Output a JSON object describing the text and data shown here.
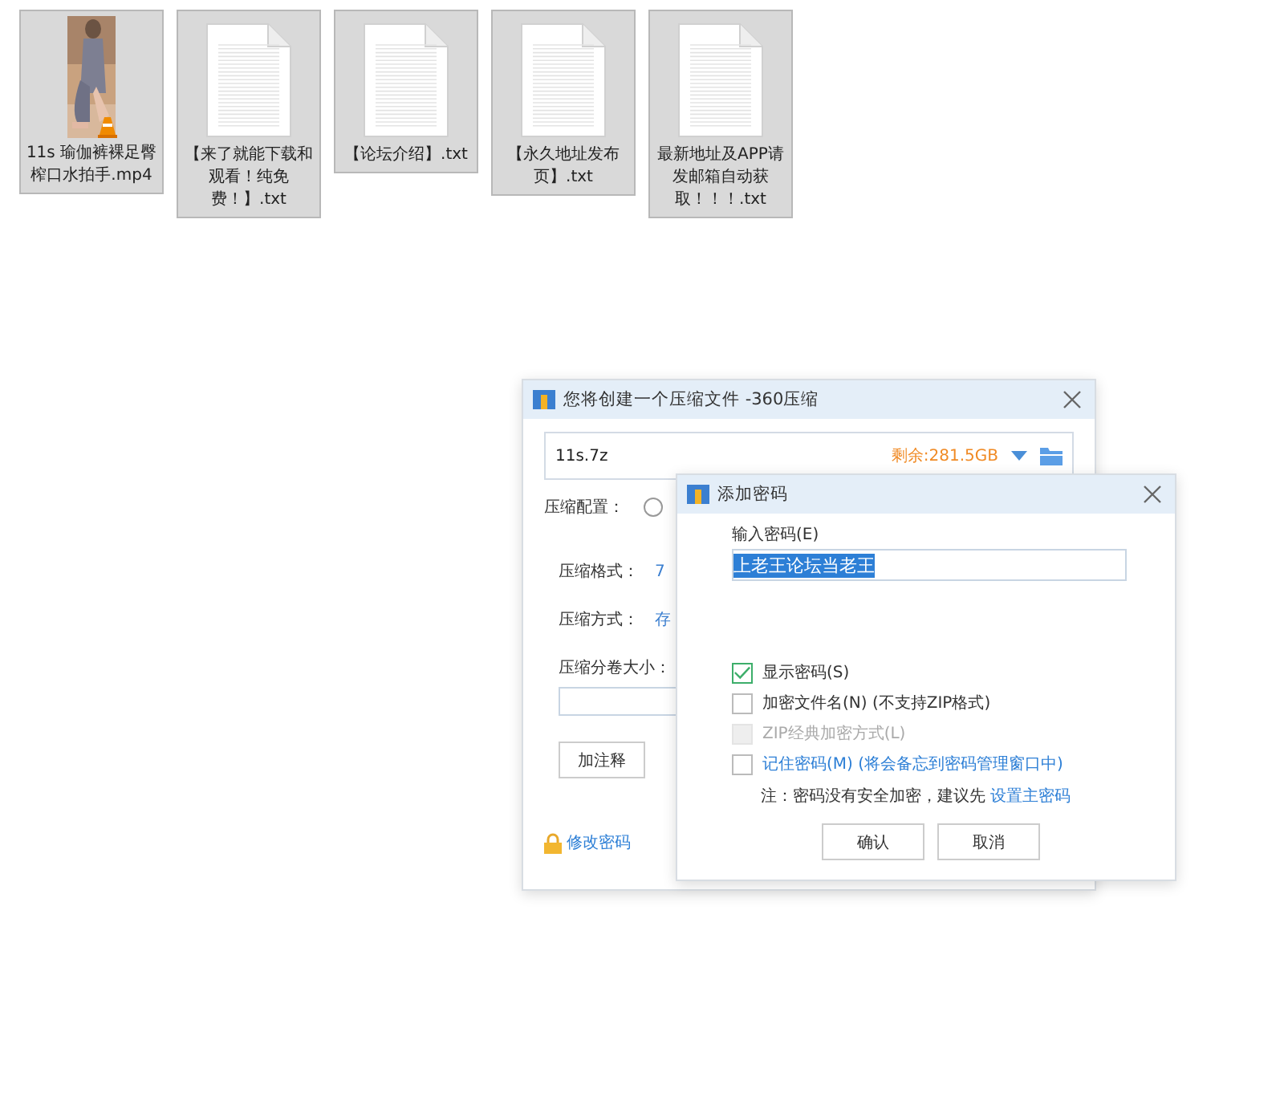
{
  "files": [
    {
      "name": "11s 瑜伽裤裸足臀榨口水拍手.mp4",
      "kind": "video",
      "selected": true
    },
    {
      "name": "【来了就能下载和观看！纯免费！】.txt",
      "kind": "text",
      "selected": true
    },
    {
      "name": "【论坛介绍】.txt",
      "kind": "text",
      "selected": true
    },
    {
      "name": "【永久地址发布页】.txt",
      "kind": "text",
      "selected": true
    },
    {
      "name": "最新地址及APP请发邮箱自动获取！！！.txt",
      "kind": "text",
      "selected": true
    }
  ],
  "compress_dialog": {
    "title": "您将创建一个压缩文件 -360压缩",
    "filename": "11s.7z",
    "free_space": "剩余:281.5GB",
    "config_label": "压缩配置：",
    "config_radio_checked": false,
    "format_label": "压缩格式：",
    "format_value": "7",
    "method_label": "压缩方式：",
    "method_value": "存",
    "volume_label": "压缩分卷大小：",
    "comment_button": "加注释",
    "change_password_link": "修改密码"
  },
  "password_dialog": {
    "title": "添加密码",
    "password_label": "输入密码(E)",
    "password_value": "上老王论坛当老王",
    "value_selected": true,
    "options": [
      {
        "label": "显示密码(S)",
        "kind": "plain",
        "checked": true,
        "disabled": false
      },
      {
        "label": "加密文件名(N) (不支持ZIP格式)",
        "kind": "plain",
        "checked": false,
        "disabled": false
      },
      {
        "label": "ZIP经典加密方式(L)",
        "kind": "plain",
        "checked": false,
        "disabled": true
      },
      {
        "label": "记住密码(M) (将会备忘到密码管理窗口中)",
        "kind": "link",
        "checked": false,
        "disabled": false
      }
    ],
    "note": "注：密码没有安全加密，建议先",
    "note_link": "设置主密码",
    "buttons": [
      "确认",
      "取消"
    ]
  }
}
